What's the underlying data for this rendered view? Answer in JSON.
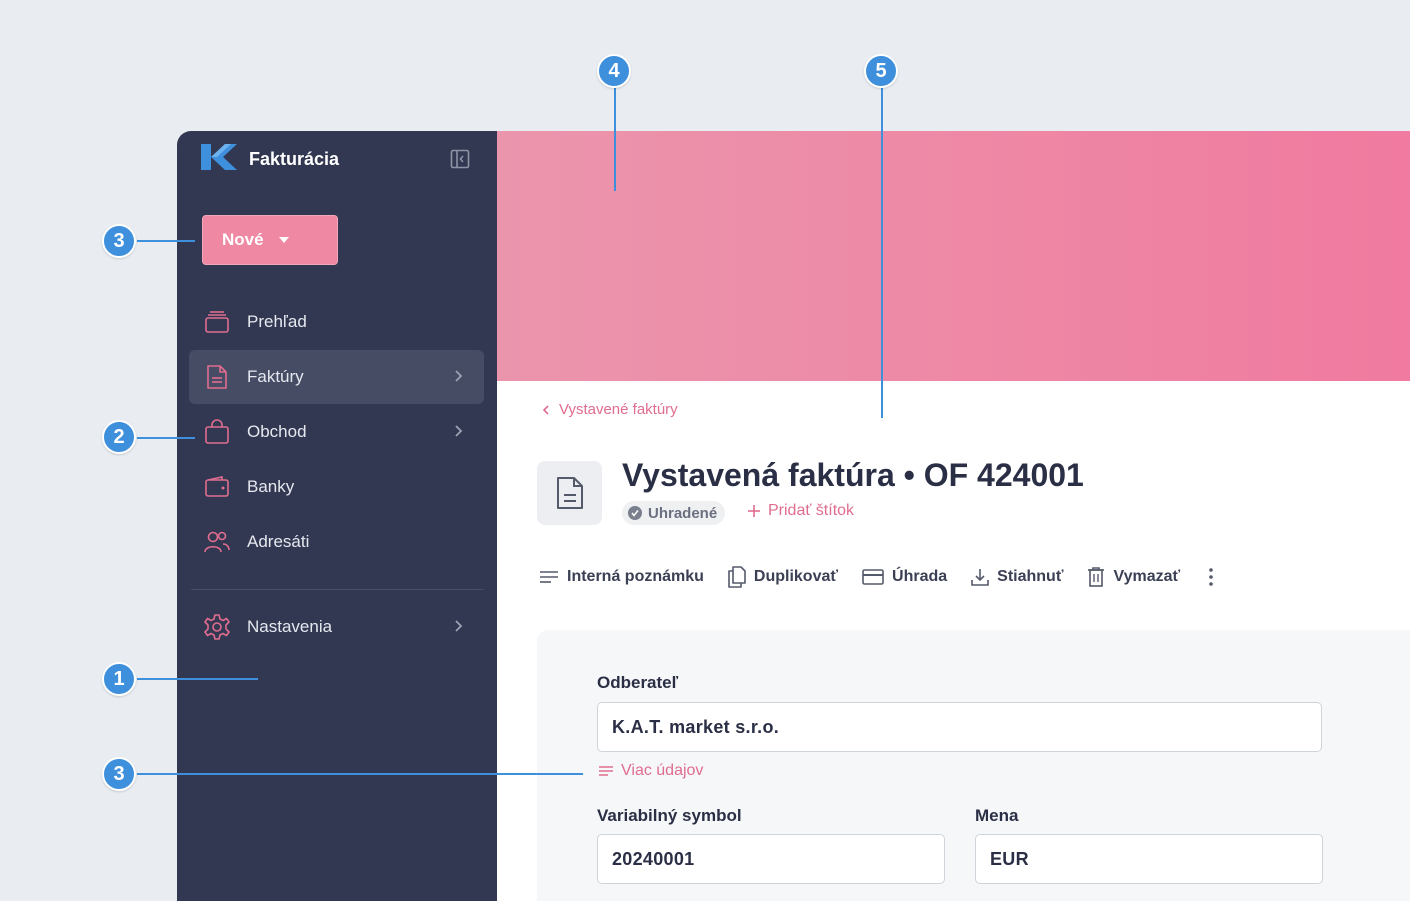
{
  "sidebar": {
    "brand": "Fakturácia",
    "new_button": "Nové",
    "items": [
      {
        "label": "Prehľad",
        "icon": "overview-icon"
      },
      {
        "label": "Faktúry",
        "icon": "invoice-icon"
      },
      {
        "label": "Obchod",
        "icon": "bag-icon"
      },
      {
        "label": "Banky",
        "icon": "wallet-icon"
      },
      {
        "label": "Adresáti",
        "icon": "users-icon"
      }
    ],
    "settings": "Nastavenia"
  },
  "main": {
    "breadcrumb": "Vystavené faktúry",
    "title": "Vystavená faktúra • OF 424001",
    "status": "Uhradené",
    "add_tag": "Pridať štítok",
    "toolbar": {
      "note": "Interná poznámku",
      "duplicate": "Duplikovať",
      "payment": "Úhrada",
      "download": "Stiahnuť",
      "delete": "Vymazať"
    },
    "form": {
      "customer_label": "Odberateľ",
      "customer_value": "K.A.T. market s.r.o.",
      "more_info": "Viac údajov",
      "vs_label": "Variabilný symbol",
      "vs_value": "20240001",
      "currency_label": "Mena",
      "currency_value": "EUR"
    }
  },
  "annotations": [
    "1",
    "2",
    "3",
    "3",
    "4",
    "5"
  ],
  "colors": {
    "sidebar": "#323851",
    "accent": "#ee88a3",
    "annotation": "#3e8fdc",
    "hero": "#ee86a4"
  }
}
